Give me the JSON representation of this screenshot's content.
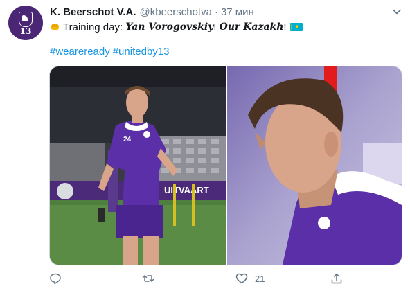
{
  "account": {
    "name": "K. Beerschot V.A.",
    "handle": "@kbeerschotva",
    "separator": "·",
    "time": "37 мин",
    "avatar_number": "13"
  },
  "tweet": {
    "prefix": "Training day: ",
    "player_name": "Yan Vorogovskiy",
    "mid": "! ",
    "nickname": "Our Kazakh",
    "suffix": "!",
    "emoji_start": "fist-icon",
    "emoji_end": "kazakhstan-flag-icon",
    "hashtags": [
      "#weareready",
      "#unitedby13"
    ]
  },
  "media": {
    "photos": [
      {
        "name": "player-running-photo",
        "jersey_number": "24",
        "banner_text": "UITVAART"
      },
      {
        "name": "player-closeup-photo"
      }
    ]
  },
  "actions": {
    "reply_icon": "reply-icon",
    "retweet_icon": "retweet-icon",
    "like_icon": "heart-icon",
    "like_count": "21",
    "share_icon": "share-icon"
  },
  "colors": {
    "brand_purple": "#4a2675",
    "link_blue": "#1b95e0",
    "muted_gray": "#657786"
  }
}
